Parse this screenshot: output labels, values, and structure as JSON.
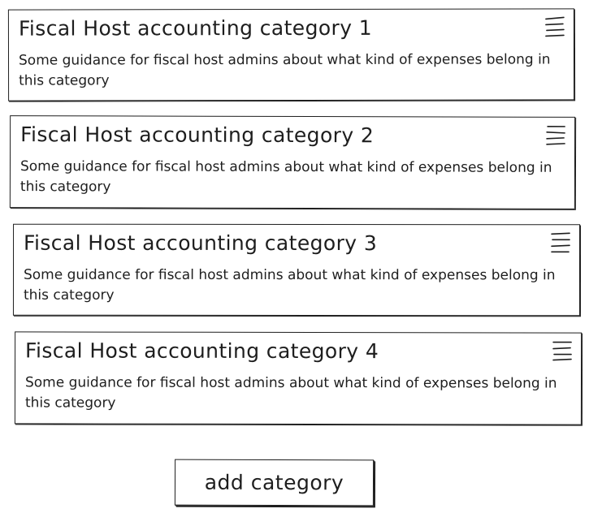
{
  "categories": [
    {
      "title": "Fiscal Host accounting category 1",
      "description": "Some guidance for fiscal host admins about what kind of expenses belong in this category",
      "handle_icon": "drag-handle-icon"
    },
    {
      "title": "Fiscal Host accounting category 2",
      "description": "Some guidance for fiscal host admins about what kind of expenses belong in this category",
      "handle_icon": "drag-handle-icon"
    },
    {
      "title": "Fiscal Host accounting category 3",
      "description": "Some guidance for fiscal host admins about what kind of expenses belong in this category",
      "handle_icon": "drag-handle-icon"
    },
    {
      "title": "Fiscal Host accounting category 4",
      "description": "Some guidance for fiscal host admins about what kind of expenses belong in this category",
      "handle_icon": "drag-handle-icon"
    }
  ],
  "add_button": {
    "label": "add category"
  },
  "colors": {
    "stroke": "#1e1e1e",
    "background": "#ffffff"
  }
}
